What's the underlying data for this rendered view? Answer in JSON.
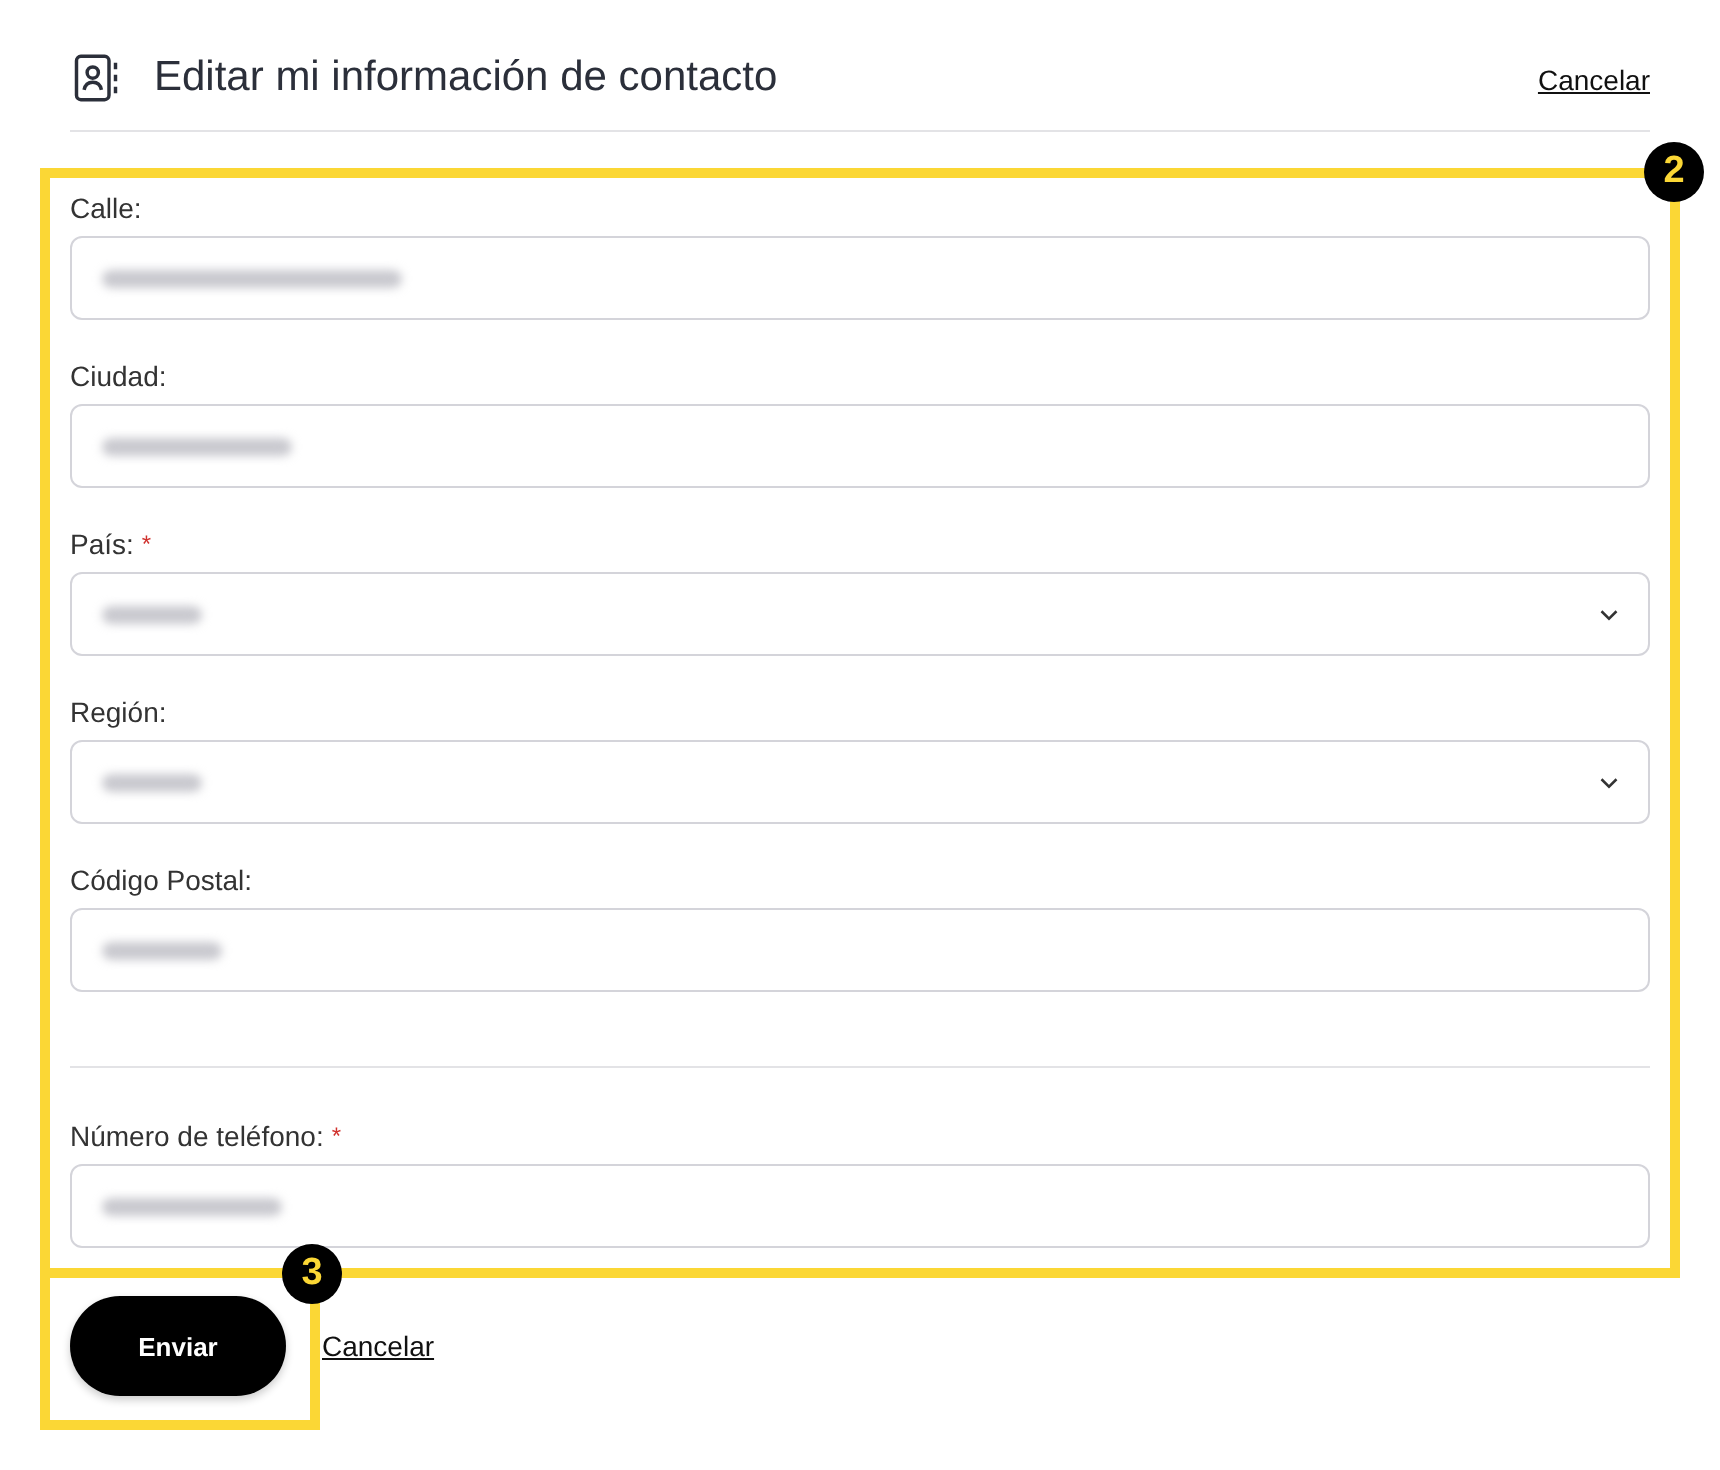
{
  "header": {
    "title": "Editar mi información de contacto",
    "cancel_link": "Cancelar"
  },
  "form": {
    "groups": [
      {
        "fields": [
          {
            "label": "Calle:",
            "kind": "text",
            "value_blurred": true
          },
          {
            "label": "Ciudad:",
            "kind": "text",
            "value_blurred": true
          },
          {
            "label": "País:",
            "required_mark": "*",
            "kind": "select",
            "value_blurred": true
          },
          {
            "label": "Región:",
            "kind": "select",
            "value_blurred": true
          },
          {
            "label": "Código Postal:",
            "kind": "text",
            "value_blurred": true
          }
        ]
      },
      {
        "fields": [
          {
            "label": "Número de teléfono:",
            "required_mark": "*",
            "kind": "text",
            "value_blurred": true
          }
        ]
      }
    ]
  },
  "actions": {
    "submit_button": "Enviar",
    "cancel_link": "Cancelar"
  },
  "annotations": [
    {
      "label": "2",
      "kind": "form"
    },
    {
      "label": "3",
      "kind": "button"
    }
  ]
}
